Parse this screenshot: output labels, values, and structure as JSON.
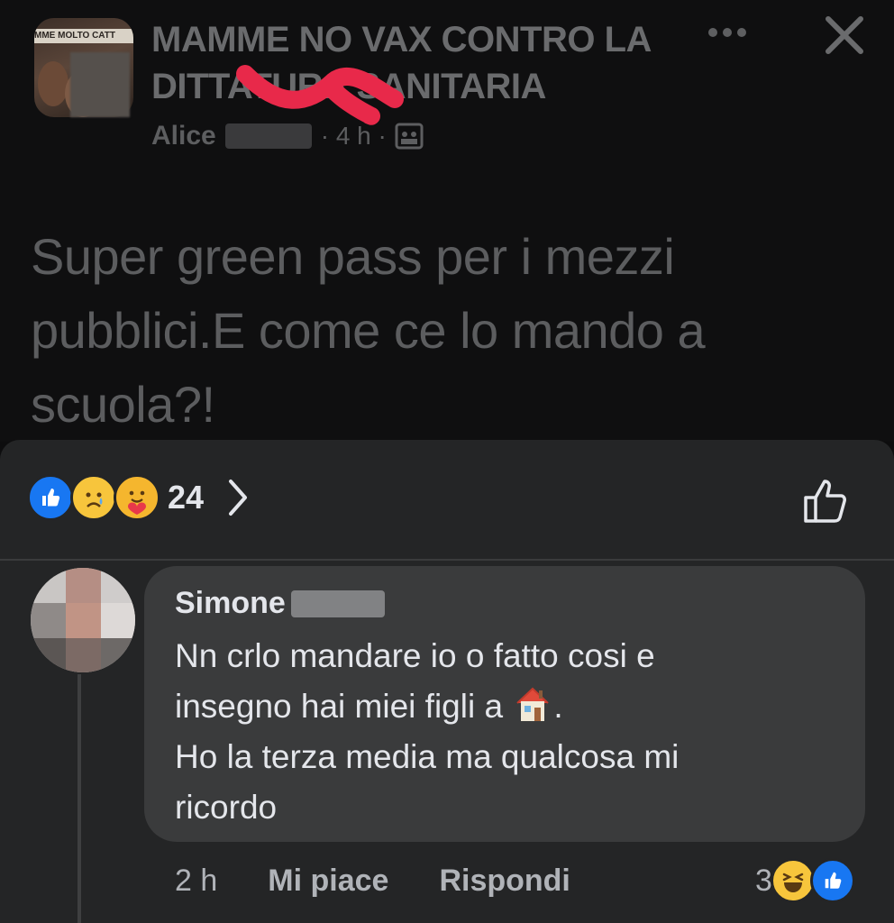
{
  "post": {
    "group_title": "MAMME NO VAX CONTRO LA DITTATURA SANITARIA",
    "group_avatar_banner": "MME MOLTO CATT",
    "author_first_name": "Alice",
    "time_meta": "· 4 h ·",
    "text": "Super green pass per i mezzi pubblici.E come ce lo mando a scuola?!"
  },
  "reactions": {
    "icons": [
      "like-icon",
      "sad-icon",
      "care-icon"
    ],
    "count": "24"
  },
  "comment": {
    "author_first_name": "Simone",
    "text_line1": "Nn crlo mandare io o fatto cosi e",
    "text_line2a": "insegno hai miei figli a",
    "text_line2b": ".",
    "text_line3": "Ho la terza media ma qualcosa mi",
    "text_line4": "ricordo",
    "emoji": "house-emoji",
    "time": "2 h",
    "like_label": "Mi piace",
    "reply_label": "Rispondi",
    "reaction_count": "3",
    "reaction_icons": [
      "haha-icon",
      "like-icon"
    ]
  },
  "colors": {
    "sheet_bg": "#242526",
    "bubble_bg": "#3a3b3c",
    "fb_blue": "#1877f2",
    "scribble_red": "#e8294a"
  }
}
